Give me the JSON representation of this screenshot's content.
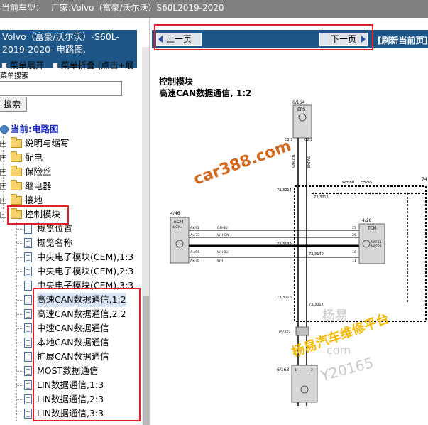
{
  "header": {
    "vehicle_label": "当前车型：",
    "vehicle_value": "厂家:Volvo（富豪/沃尔沃）S60L2019-2020"
  },
  "left_pane": {
    "title": "Volvo（富豪/沃尔沃）-S60L-2019-2020- 电路图.",
    "expand_all": "菜单展开",
    "collapse_all": "菜单折叠",
    "collapse_hint": "(点击+展",
    "search_label": "菜单搜索",
    "search_value": "",
    "search_button": "搜索",
    "current_label": "当前:电路图",
    "tree": [
      {
        "label": "说明与缩写",
        "type": "folder",
        "expander": "+"
      },
      {
        "label": "配电",
        "type": "folder",
        "expander": "+"
      },
      {
        "label": "保险丝",
        "type": "folder",
        "expander": "+"
      },
      {
        "label": "继电器",
        "type": "folder",
        "expander": "+"
      },
      {
        "label": "接地",
        "type": "folder",
        "expander": "+"
      },
      {
        "label": "控制模块",
        "type": "folder",
        "expander": "-"
      },
      {
        "label": "概览位置",
        "type": "page"
      },
      {
        "label": "概览名称",
        "type": "page"
      },
      {
        "label": "中央电子模块(CEM),1:3",
        "type": "page"
      },
      {
        "label": "中央电子模块(CEM),2:3",
        "type": "page"
      },
      {
        "label": "中央电子模块(CEM),3:3",
        "type": "page"
      },
      {
        "label": "高速CAN数据通信,1:2",
        "type": "page",
        "selected": true
      },
      {
        "label": "高速CAN数据通信,2:2",
        "type": "page"
      },
      {
        "label": "中速CAN数据通信",
        "type": "page"
      },
      {
        "label": "本地CAN数据通信",
        "type": "page"
      },
      {
        "label": "扩展CAN数据通信",
        "type": "page"
      },
      {
        "label": "MOST数据通信",
        "type": "page"
      },
      {
        "label": "LIN数据通信,1:3",
        "type": "page"
      },
      {
        "label": "LIN数据通信,2:3",
        "type": "page"
      },
      {
        "label": "LIN数据通信,3:3",
        "type": "page"
      }
    ]
  },
  "right_pane": {
    "prev_button": "上一页",
    "next_button": "下一页",
    "refresh": "[刷新当前页]",
    "diagram_title": "控制模块",
    "diagram_subtitle": "高速CAN数据通信, 1:2",
    "modules": {
      "eps": {
        "ref": "6/164",
        "name": "EPS"
      },
      "ecm": {
        "ref": "4/46",
        "name": "ECM",
        "sub": "4 CYL"
      },
      "tcm": {
        "ref": "4/28",
        "name": "TCM",
        "sub1": "AWF21",
        "sub2": "AWF22"
      },
      "bottom": {
        "ref": "6/163"
      },
      "right_ref": "74"
    },
    "connectors": [
      "C2:1",
      "C2:2",
      "73/3014",
      "73/3015",
      "73/3139",
      "73/3140",
      "73/3016",
      "73/3017",
      "74/323"
    ],
    "pins": {
      "ecm_a": "Ax:92",
      "ecm_b": "Ax:73",
      "ecm_c": "Ax:56",
      "ecm_d": "Ax:76",
      "tcm_a": "25",
      "tcm_b": "26",
      "tcm_c": "10",
      "tcm_d": "11",
      "bottom_a": "1",
      "bottom_b": "2"
    },
    "wires": {
      "gnbu": "GN-BU",
      "whgn": "WH-GN",
      "whbu": "WH-BU",
      "wh": "WH",
      "ehpas": "EHPAS"
    },
    "watermarks": {
      "site": "car388.com",
      "brand": "杨易",
      "platform": "杨易汽车维修平台",
      "partial": "com",
      "wechat": "Y20165"
    }
  }
}
